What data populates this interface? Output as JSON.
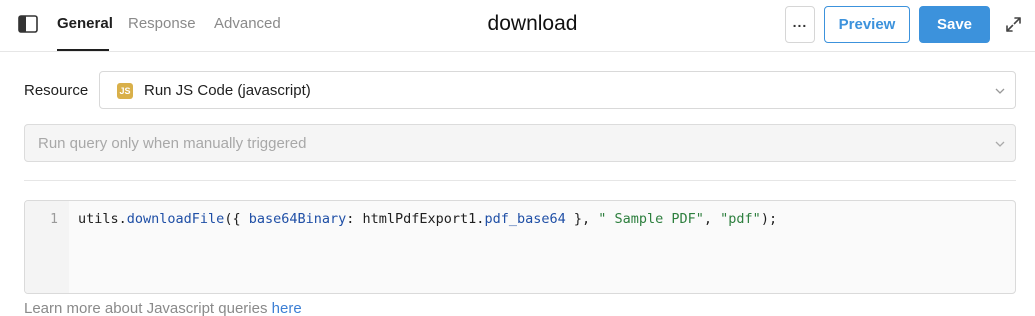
{
  "header": {
    "title": "download",
    "tabs": [
      {
        "label": "General",
        "active": true
      },
      {
        "label": "Response",
        "active": false
      },
      {
        "label": "Advanced",
        "active": false
      }
    ],
    "more_label": "...",
    "preview_label": "Preview",
    "save_label": "Save"
  },
  "resource": {
    "label": "Resource",
    "icon_text": "JS",
    "value": "Run JS Code (javascript)"
  },
  "trigger": {
    "value": "Run query only when manually triggered"
  },
  "editor": {
    "line_number": "1",
    "tokens": [
      {
        "text": "utils.",
        "kind": "plain"
      },
      {
        "text": "downloadFile",
        "kind": "fn"
      },
      {
        "text": "({ ",
        "kind": "plain"
      },
      {
        "text": "base64Binary",
        "kind": "prop"
      },
      {
        "text": ": htmlPdfExport1.",
        "kind": "plain"
      },
      {
        "text": "pdf_base64",
        "kind": "prop"
      },
      {
        "text": " }, ",
        "kind": "plain"
      },
      {
        "text": "\" Sample PDF\"",
        "kind": "str"
      },
      {
        "text": ", ",
        "kind": "plain"
      },
      {
        "text": "\"pdf\"",
        "kind": "str"
      },
      {
        "text": ");",
        "kind": "plain"
      }
    ]
  },
  "footer": {
    "text": "Learn more about Javascript queries ",
    "link": "here"
  },
  "colors": {
    "accent": "#3c92dc",
    "js_badge": "#d9b04a",
    "string": "#2d7f3e",
    "identifier": "#1f4fa6"
  },
  "icons": {
    "panel_toggle": "sidebar-panel-icon",
    "expand": "expand-icon",
    "chevron": "chevron-down-icon"
  }
}
